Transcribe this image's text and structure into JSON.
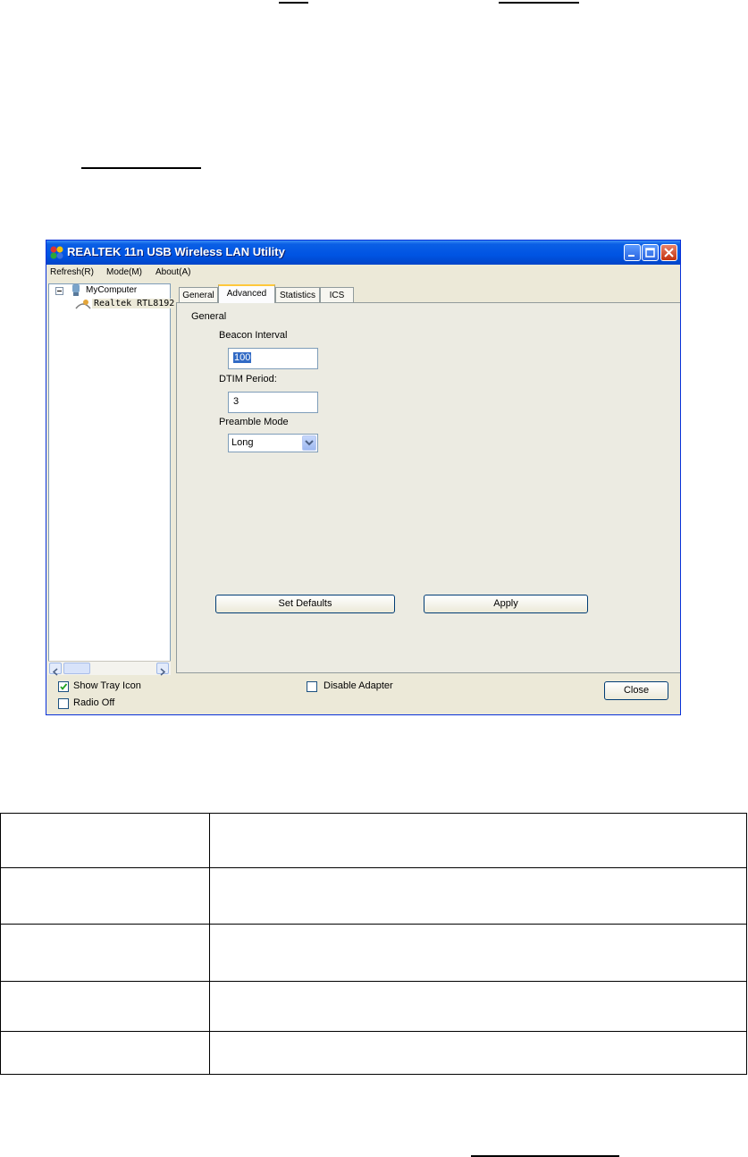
{
  "window": {
    "title": "REALTEK 11n USB Wireless LAN Utility",
    "menu": [
      "Refresh(R)",
      "Mode(M)",
      "About(A)"
    ]
  },
  "tree": {
    "root": "MyComputer",
    "child": "Realtek RTL8192"
  },
  "tabs": [
    "General",
    "Advanced",
    "Statistics",
    "ICS"
  ],
  "active_tab": "Advanced",
  "advanced": {
    "group_label": "General",
    "beacon_label": "Beacon Interval",
    "beacon_value": "100",
    "dtim_label": "DTIM Period:",
    "dtim_value": "3",
    "preamble_label": "Preamble Mode",
    "preamble_value": "Long",
    "set_defaults_label": "Set Defaults",
    "apply_label": "Apply"
  },
  "bottom": {
    "show_tray_label": "Show Tray Icon",
    "show_tray_checked": true,
    "radio_off_label": "Radio Off",
    "radio_off_checked": false,
    "disable_adapter_label": "Disable Adapter",
    "disable_adapter_checked": false,
    "close_label": "Close"
  },
  "table_rows": 5
}
